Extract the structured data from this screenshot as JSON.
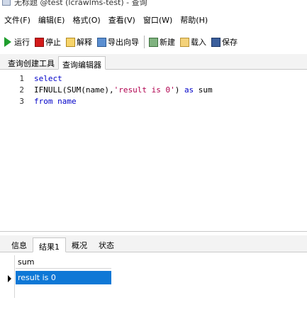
{
  "window": {
    "title": "无标题 @test (lcrawlms-test) - 查询"
  },
  "menu": {
    "items": [
      "文件(F)",
      "编辑(E)",
      "格式(O)",
      "查看(V)",
      "窗口(W)",
      "帮助(H)"
    ]
  },
  "toolbar": {
    "run": "运行",
    "stop": "停止",
    "explain": "解释",
    "export": "导出向导",
    "new": "新建",
    "load": "载入",
    "save": "保存"
  },
  "query_tabs": {
    "builder": "查询创建工具",
    "editor": "查询编辑器"
  },
  "editor": {
    "lines": [
      {
        "num": "1",
        "tokens": [
          {
            "t": "select",
            "c": "kw"
          }
        ]
      },
      {
        "num": "2",
        "tokens": [
          {
            "t": "IFNULL(SUM(name),",
            "c": "plain"
          },
          {
            "t": "'result is 0'",
            "c": "str"
          },
          {
            "t": ") ",
            "c": "plain"
          },
          {
            "t": "as",
            "c": "kw"
          },
          {
            "t": " sum",
            "c": "plain"
          }
        ]
      },
      {
        "num": "3",
        "tokens": [
          {
            "t": "from",
            "c": "kw"
          },
          {
            "t": " name",
            "c": "kw"
          }
        ]
      }
    ]
  },
  "result_tabs": {
    "info": "信息",
    "result1": "结果1",
    "profile": "概况",
    "status": "状态"
  },
  "results": {
    "columns": [
      "sum"
    ],
    "rows": [
      [
        "result is 0"
      ]
    ]
  },
  "colors": {
    "selection": "#0f78d6",
    "keyword": "#0000c8",
    "string": "#b0004e"
  }
}
